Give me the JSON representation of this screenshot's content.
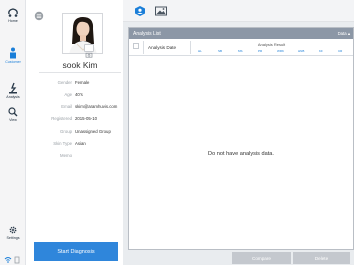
{
  "nav": {
    "home_label": "Home",
    "customer_label": "Customer",
    "analysis_label": "Analysis",
    "view_label": "View",
    "settings_label": "Settings"
  },
  "profile": {
    "name": "sook Kim",
    "fields": [
      {
        "label": "Gender",
        "value": "Female"
      },
      {
        "label": "Age",
        "value": "40's"
      },
      {
        "label": "Email",
        "value": "skim@aramhuvis.com"
      },
      {
        "label": "Registered",
        "value": "2015-05-10"
      },
      {
        "label": "Group",
        "value": "Unassigned Group"
      },
      {
        "label": "Skin Type",
        "value": "Asian"
      },
      {
        "label": "Memo",
        "value": ""
      }
    ],
    "start_button": "Start Diagnosis"
  },
  "analysis_list": {
    "title": "Analysis List",
    "sort_label": "Data ▴",
    "col_date": "Analysis Date",
    "col_result": "Analysis Result",
    "sub_cols": [
      "HL",
      "SB",
      "MS",
      "PR",
      "WRK",
      "HNB",
      "KF",
      "CR"
    ],
    "empty_message": "Do not have analysis data."
  },
  "footer": {
    "compare": "Compare",
    "delete": "Delete"
  },
  "colors": {
    "accent": "#2f86db",
    "header_bar": "#8c97a6",
    "disabled_button": "#c4c8ce"
  },
  "icons": [
    "home-icon",
    "customer-icon",
    "analysis-icon",
    "view-icon",
    "settings-icon",
    "wifi-icon",
    "battery-icon",
    "menu-icon",
    "profile-tab-icon",
    "image-tab-icon",
    "edit-photo-icon"
  ]
}
